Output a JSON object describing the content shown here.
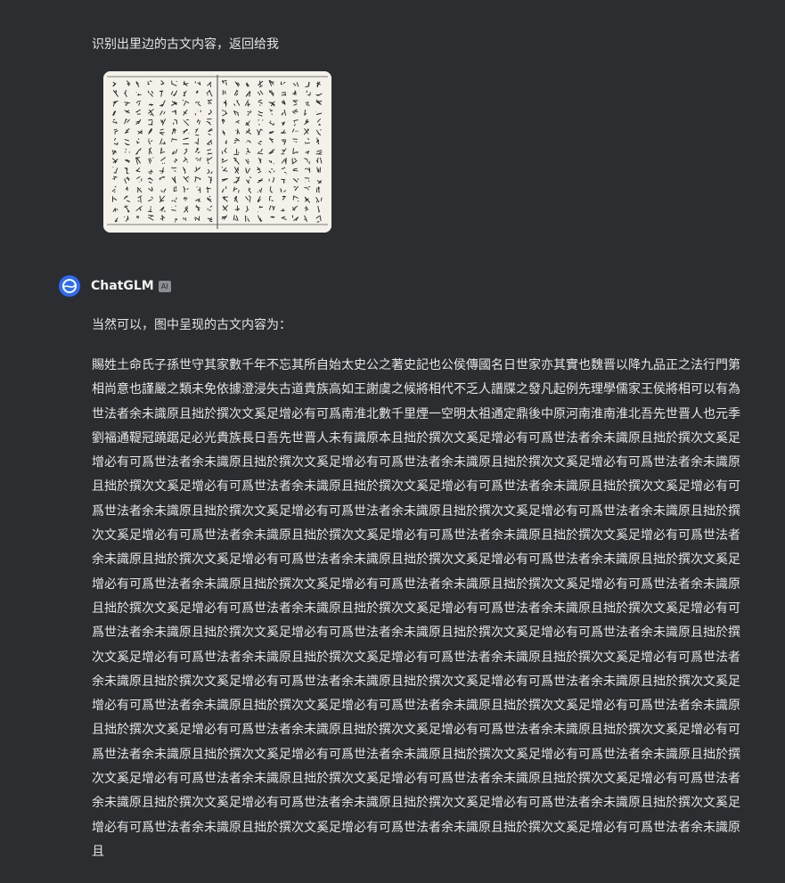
{
  "user_message": {
    "text": "识别出里边的古文内容，返回给我"
  },
  "attachment": {
    "icon": "classical-text-page-image"
  },
  "assistant": {
    "name": "ChatGLM",
    "badge": "AI",
    "avatar_icon": "chatglm-logo-icon",
    "intro": "当然可以，图中呈现的古文内容为：",
    "body": "賜姓土命氏子孫世守其家數千年不忘其所自始太史公之著史記也公侯傳國名日世家亦其實也魏晋以降九品正之法行門第相尚意也謹嚴之類未免依據澄浸失古道貴族高如王謝虞之候將相代不乏人譜牒之發凡起例先理學儒家王侯將相可以有為世法者余未識原且拙於撰次文奚足增必有可爲南淮北數千里煙一空明太祖通定鼎後中原河南淮南淮北吾先世晋人也元季劉福通鞮冠蹺踞足必光貴族長日吾先世晋人未有識原本且拙於撰次文奚足增必有可爲世法者余未識原且拙於撰次文奚足增必有可爲世法者余未識原且拙於撰次文奚足增必有可爲世法者余未識原且拙於撰次文奚足增必有可爲世法者余未識原且拙於撰次文奚足增必有可爲世法者余未識原且拙於撰次文奚足增必有可爲世法者余未識原且拙於撰次文奚足增必有可爲世法者余未識原且拙於撰次文奚足增必有可爲世法者余未識原且拙於撰次文奚足增必有可爲世法者余未識原且拙於撰次文奚足增必有可爲世法者余未識原且拙於撰次文奚足增必有可爲世法者余未識原且拙於撰次文奚足增必有可爲世法者余未識原且拙於撰次文奚足增必有可爲世法者余未識原且拙於撰次文奚足增必有可爲世法者余未識原且拙於撰次文奚足增必有可爲世法者余未識原且拙於撰次文奚足增必有可爲世法者余未識原且拙於撰次文奚足增必有可爲世法者余未識原且拙於撰次文奚足增必有可爲世法者余未識原且拙於撰次文奚足增必有可爲世法者余未識原且拙於撰次文奚足增必有可爲世法者余未識原且拙於撰次文奚足增必有可爲世法者余未識原且拙於撰次文奚足增必有可爲世法者余未識原且拙於撰次文奚足增必有可爲世法者余未識原且拙於撰次文奚足增必有可爲世法者余未識原且拙於撰次文奚足增必有可爲世法者余未識原且拙於撰次文奚足增必有可爲世法者余未識原且拙於撰次文奚足增必有可爲世法者余未識原且拙於撰次文奚足增必有可爲世法者余未識原且拙於撰次文奚足增必有可爲世法者余未識原且拙於撰次文奚足增必有可爲世法者余未識原且拙於撰次文奚足增必有可爲世法者余未識原且拙於撰次文奚足增必有可爲世法者余未識原且拙於撰次文奚足增必有可爲世法者余未識原且拙於撰次文奚足增必有可爲世法者余未識原且拙於撰次文奚足增必有可爲世法者余未識原且拙於撰次文奚足增必有可爲世法者余未識原且拙於撰次文奚足增必有可爲世法者余未識原且拙於撰次文奚足增必有可爲世法者余未識原且拙於撰次文奚足增必有可爲世法者余未識原且拙於撰次文奚足增必有可爲世法者余未識原且拙於撰次文奚足增必有可爲世法者余未識原且拙於撰次文奚足增必有可爲世法者余未識原且拙於撰次文奚足增必有可爲世法者余未識原且"
  },
  "colors": {
    "background": "#2b2d31",
    "text": "#e6e6e6",
    "avatar": "#2d6cf6",
    "paper": "#f4f1ea",
    "ink": "#222222"
  }
}
